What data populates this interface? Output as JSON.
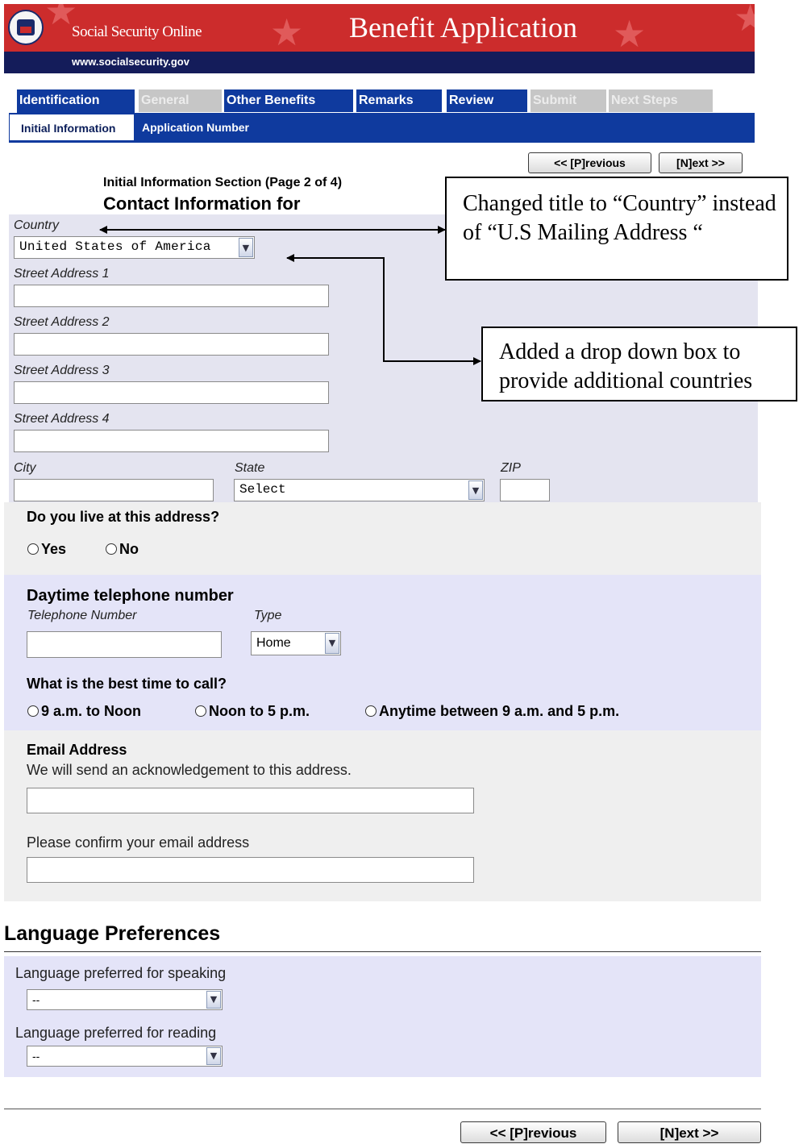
{
  "header": {
    "site_name": "Social Security Online",
    "url": "www.socialsecurity.gov",
    "title": "Benefit Application",
    "colors": {
      "banner_red": "#cc2c2c",
      "banner_navy": "#141c5a",
      "tab_blue": "#0f3a9e",
      "tab_disabled": "#c6c6c6"
    }
  },
  "tabs": [
    {
      "label": "Identification",
      "state": "active"
    },
    {
      "label": "General",
      "state": "disabled"
    },
    {
      "label": "Other Benefits",
      "state": "enabled"
    },
    {
      "label": "Remarks",
      "state": "enabled"
    },
    {
      "label": "Review",
      "state": "enabled"
    },
    {
      "label": "Submit",
      "state": "disabled"
    },
    {
      "label": "Next Steps",
      "state": "disabled"
    }
  ],
  "subtabs": [
    {
      "label": "Initial Information",
      "state": "active"
    },
    {
      "label": "Application Number",
      "state": "enabled"
    }
  ],
  "nav": {
    "previous": "<< [P]revious",
    "next": "[N]ext >>"
  },
  "section": {
    "title": "Initial Information Section (Page 2 of 4)",
    "heading": "Contact Information for"
  },
  "address": {
    "country_label": "Country",
    "country_value": "United States of America",
    "street1_label": "Street Address 1",
    "street2_label": "Street Address 2",
    "street3_label": "Street Address 3",
    "street4_label": "Street Address 4",
    "city_label": "City",
    "state_label": "State",
    "state_value": "Select",
    "zip_label": "ZIP"
  },
  "live": {
    "question": "Do you live at this address?",
    "yes": "Yes",
    "no": "No"
  },
  "phone": {
    "heading": "Daytime telephone number",
    "number_label": "Telephone Number",
    "type_label": "Type",
    "type_value": "Home",
    "best_time_question": "What is the best time to call?",
    "options": [
      "9 a.m. to Noon",
      "Noon to 5 p.m.",
      "Anytime between 9 a.m. and 5 p.m."
    ]
  },
  "email": {
    "heading": "Email Address",
    "note": "We will send an acknowledgement to this address.",
    "confirm_label": "Please confirm your email address"
  },
  "language": {
    "heading": "Language Preferences",
    "speaking_label": "Language preferred for speaking",
    "speaking_value": "--",
    "reading_label": "Language preferred for reading",
    "reading_value": "--"
  },
  "callouts": {
    "country": "Changed title to “Country” instead of “U.S Mailing Address “",
    "dropdown": "Added a drop down box to provide additional countries"
  },
  "icons": {
    "dropdown_arrow": "chevron-down-icon",
    "radio": "radio-unchecked-icon"
  }
}
